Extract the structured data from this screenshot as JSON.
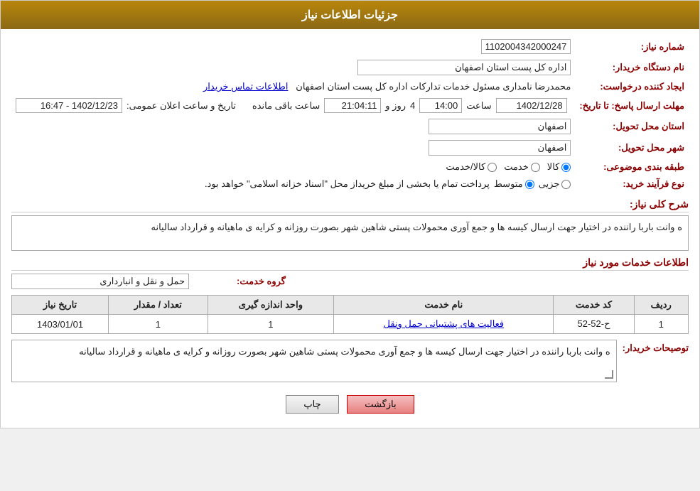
{
  "header": {
    "title": "جزئیات اطلاعات نیاز"
  },
  "fields": {
    "need_number_label": "شماره نیاز:",
    "need_number_value": "1102004342000247",
    "buyer_org_label": "نام دستگاه خریدار:",
    "buyer_org_value": "اداره کل پست استان اصفهان",
    "creator_label": "ایجاد کننده درخواست:",
    "creator_value": "محمدرضا نامداری مسئول خدمات تدارکات اداره کل پست استان اصفهان",
    "creator_link": "اطلاعات تماس خریدار",
    "date_label": "تاریخ و ساعت اعلان عمومی:",
    "date_value": "1402/12/23 - 16:47",
    "send_date_label": "مهلت ارسال پاسخ: تا تاریخ:",
    "send_date_value": "1402/12/28",
    "send_time_label": "ساعت",
    "send_time_value": "14:00",
    "remaining_days_label": "روز و",
    "remaining_days_value": "4",
    "remaining_time_value": "21:04:11",
    "remaining_label": "ساعت باقی مانده",
    "province_label": "استان محل تحویل:",
    "province_value": "اصفهان",
    "city_label": "شهر محل تحویل:",
    "city_value": "اصفهان",
    "category_label": "طبقه بندی موضوعی:",
    "category_options": [
      "کالا",
      "خدمت",
      "کالا/خدمت"
    ],
    "category_selected": "کالا",
    "process_label": "نوع فرآیند خرید:",
    "process_options": [
      "جزیی",
      "متوسط"
    ],
    "process_selected": "متوسط",
    "process_note": "پرداخت تمام یا بخشی از مبلغ خریداز محل \"اسناد خزانه اسلامی\" خواهد بود.",
    "need_summary_label": "شرح کلی نیاز:",
    "need_summary_value": "ه وانت باربا راننده در اختیار جهت ارسال کیسه ها و جمع آوری محمولات پستی شاهین شهر بصورت روزانه و کرایه ی ماهیانه و قرارداد سالیانه",
    "services_info_label": "اطلاعات خدمات مورد نیاز",
    "service_group_label": "گروه خدمت:",
    "service_group_value": "حمل و نقل و انبارداری"
  },
  "table": {
    "headers": [
      "ردیف",
      "کد خدمت",
      "نام خدمت",
      "واحد اندازه گیری",
      "تعداد / مقدار",
      "تاریخ نیاز"
    ],
    "rows": [
      {
        "row": "1",
        "code": "ح-52-52",
        "name": "فعالیت های پشتیبانی حمل ونقل",
        "unit": "1",
        "qty": "1",
        "date": "1403/01/01"
      }
    ]
  },
  "buyer_notes_label": "توصیحات خریدار:",
  "buyer_notes_value": "ه وانت باربا راننده در اختیار جهت ارسال کیسه ها و جمع آوری محمولات پستی شاهین شهر بصورت روزانه و کرایه ی ماهیانه و قرارداد سالیانه",
  "buttons": {
    "back_label": "بازگشت",
    "print_label": "چاپ"
  }
}
